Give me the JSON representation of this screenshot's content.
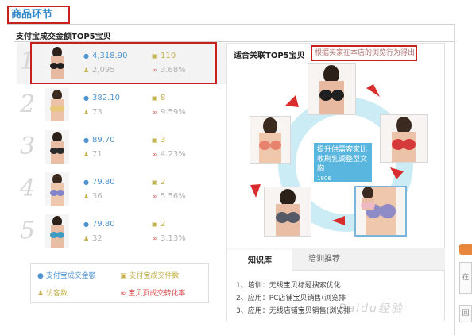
{
  "page_title": "商品环节",
  "section_title": "支付宝成交金额TOP5宝贝",
  "products": [
    {
      "rank": "1",
      "amount": "4,318.90",
      "qty": "110",
      "visitors": "2,095",
      "conv": "3.68%",
      "suit": "#202020",
      "skin": "#e6b9a0"
    },
    {
      "rank": "2",
      "amount": "382.10",
      "qty": "8",
      "visitors": "73",
      "conv": "9.59%",
      "suit": "#e8c87a",
      "skin": "#ecc3a8"
    },
    {
      "rank": "3",
      "amount": "89.70",
      "qty": "3",
      "visitors": "71",
      "conv": "4.23%",
      "suit": "#2a2a2a",
      "skin": "#e9bea4"
    },
    {
      "rank": "4",
      "amount": "79.80",
      "qty": "2",
      "visitors": "36",
      "conv": "5.56%",
      "suit": "#7f86c9",
      "skin": "#eec7ad"
    },
    {
      "rank": "5",
      "amount": "79.80",
      "qty": "2",
      "visitors": "32",
      "conv": "3.13%",
      "suit": "#3f9ac4",
      "skin": "#e9bda3"
    }
  ],
  "legend": {
    "amount": "支付宝成交金额",
    "qty": "支付宝成交件数",
    "visitors": "访客数",
    "conv": "宝贝页成交转化率"
  },
  "icons": {
    "amount": "coin-icon",
    "qty": "bag-icon",
    "visitors": "people-icon",
    "conv": "infinity-icon"
  },
  "related": {
    "title": "适合关联TOP5宝贝",
    "note": "根据买家在本店的浏览行为得出",
    "center_text": "提升供需客家比收刷乳调整型文胸",
    "center_sub": "1806",
    "items": [
      {
        "suit": "#202020",
        "skin": "#e6b9a0"
      },
      {
        "suit": "#d43a3a",
        "skin": "#ecc3a8"
      },
      {
        "suit": "#e8846e",
        "skin": "#eec7ad"
      },
      {
        "suit": "#555a66",
        "skin": "#e9bea4"
      },
      {
        "suit": "#8f8bc6",
        "skin": "#eec7ad"
      },
      {
        "suit": "#efb9c4",
        "skin": "#e9bda3"
      }
    ]
  },
  "tabs": [
    "知识库",
    "培训推荐"
  ],
  "tips": [
    "1、培训：无线宝贝标题搜索优化",
    "2、应用：PC店铺宝贝销售(浏览排",
    "3、应用：无线店铺宝贝销售(浏览排"
  ],
  "side": {
    "label_a": "在",
    "label_b": "回"
  },
  "watermark": "Baidu经验",
  "colors": {
    "accent_blue": "#4f93d1",
    "gold": "#c3b14c",
    "red_border": "#c8201d",
    "ring": "#cbecf4",
    "center_card": "#59b6df",
    "arrow": "#d92d2d"
  }
}
